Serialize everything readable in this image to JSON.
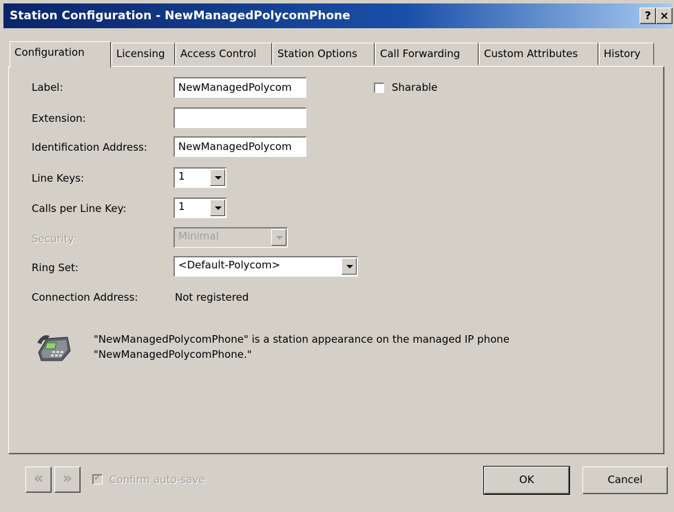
{
  "window": {
    "title": "Station Configuration - NewManagedPolycomPhone",
    "help_glyph": "?",
    "close_glyph": "×"
  },
  "tabs": [
    {
      "label": "Configuration"
    },
    {
      "label": "Licensing"
    },
    {
      "label": "Access Control"
    },
    {
      "label": "Station Options"
    },
    {
      "label": "Call Forwarding"
    },
    {
      "label": "Custom Attributes"
    },
    {
      "label": "History"
    }
  ],
  "form": {
    "label": {
      "label": "Label:",
      "value": "NewManagedPolycom"
    },
    "sharable": {
      "label": "Sharable",
      "checked": false
    },
    "extension": {
      "label": "Extension:",
      "value": ""
    },
    "identification": {
      "label": "Identification Address:",
      "value": "NewManagedPolycom"
    },
    "line_keys": {
      "label": "Line Keys:",
      "value": "1"
    },
    "calls_per_line": {
      "label": "Calls per Line Key:",
      "value": "1"
    },
    "security": {
      "label": "Security:",
      "value": "Minimal"
    },
    "ring_set": {
      "label": "Ring Set:",
      "value": "<Default-Polycom>"
    },
    "connection": {
      "label": "Connection Address:",
      "value": "Not registered"
    }
  },
  "info": {
    "line1": "\"NewManagedPolycomPhone\" is a station appearance on the managed IP phone",
    "line2": "\"NewManagedPolycomPhone.\"",
    "icon": "ip-phone-icon"
  },
  "footer": {
    "prev_glyph": "«",
    "next_glyph": "»",
    "confirm_label": "Confirm auto-save",
    "confirm_checked": true,
    "ok_label": "OK",
    "cancel_label": "Cancel"
  }
}
